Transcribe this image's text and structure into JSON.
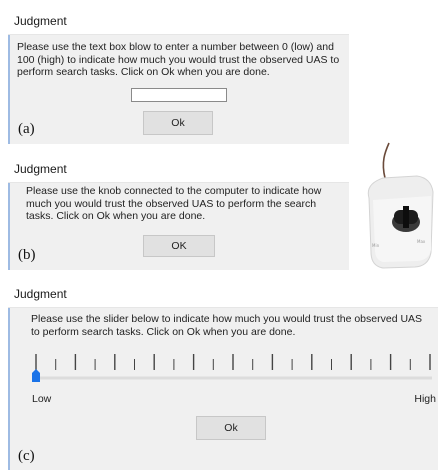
{
  "panels": {
    "a": {
      "title": "Judgment",
      "message": "Please use the text box blow to enter a number between 0 (low) and 100 (high) to indicate how much you would trust the observed UAS to perform search tasks. Click on Ok when you are done.",
      "input_value": "",
      "ok_label": "Ok",
      "tag": "(a)"
    },
    "b": {
      "title": "Judgment",
      "message": "Please use the knob connected to the computer to indicate how much you would trust the observed UAS to perform the search tasks. Click on Ok when you are done.",
      "ok_label": "OK",
      "tag": "(b)",
      "knob_labels": {
        "min": "Min",
        "max": "Max"
      }
    },
    "c": {
      "title": "Judgment",
      "message": "Please use the slider below to indicate how much you would trust the observed UAS to perform search tasks. Click on Ok when you are done.",
      "slider_low_label": "Low",
      "slider_high_label": "High",
      "slider_value": 0,
      "ok_label": "Ok",
      "tag": "(c)"
    }
  },
  "colors": {
    "dialog_bg": "#f0f0f0",
    "slider_thumb": "#1a73e8",
    "panel_edge": "#9ebbe3"
  }
}
